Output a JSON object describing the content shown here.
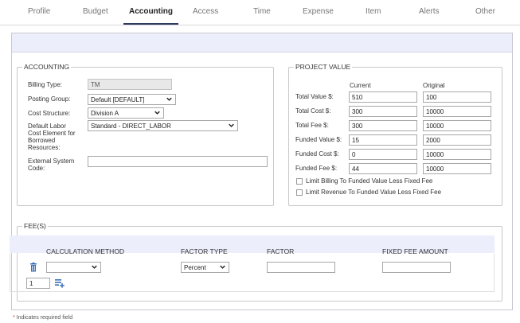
{
  "tabs": [
    {
      "label": "Profile"
    },
    {
      "label": "Budget"
    },
    {
      "label": "Accounting"
    },
    {
      "label": "Access"
    },
    {
      "label": "Time"
    },
    {
      "label": "Expense"
    },
    {
      "label": "Item"
    },
    {
      "label": "Alerts"
    },
    {
      "label": "Other"
    }
  ],
  "accounting": {
    "legend": "ACCOUNTING",
    "billing_type_label": "Billing Type:",
    "billing_type_value": "TM",
    "posting_group_label": "Posting Group:",
    "posting_group_value": "Default [DEFAULT]",
    "cost_structure_label": "Cost Structure:",
    "cost_structure_value": "Division A",
    "labor_cost_label_1": "Default Labor",
    "labor_cost_label_2": "Cost Element for",
    "labor_cost_label_3": "Borrowed",
    "labor_cost_label_4": "Resources:",
    "labor_cost_value": "Standard - DIRECT_LABOR",
    "external_code_label_1": "External System",
    "external_code_label_2": "Code:",
    "external_code_value": ""
  },
  "project_value": {
    "legend": "PROJECT VALUE",
    "col_current": "Current",
    "col_original": "Original",
    "rows": [
      {
        "label": "Total Value $:",
        "current": "510",
        "original": "100"
      },
      {
        "label": "Total Cost $:",
        "current": "300",
        "original": "10000"
      },
      {
        "label": "Total Fee $:",
        "current": "300",
        "original": "10000"
      },
      {
        "label": "Funded Value $:",
        "current": "15",
        "original": "2000"
      },
      {
        "label": "Funded Cost $:",
        "current": "0",
        "original": "10000"
      },
      {
        "label": "Funded Fee $:",
        "current": "44",
        "original": "10000"
      }
    ],
    "limit_billing_label": "Limit Billing To Funded Value Less Fixed Fee",
    "limit_revenue_label": "Limit Revenue To Funded Value Less Fixed Fee"
  },
  "fees": {
    "legend": "FEE(S)",
    "col_calc": "CALCULATION METHOD",
    "col_factor_type": "FACTOR TYPE",
    "col_factor": "FACTOR",
    "col_fixed_fee": "FIXED FEE AMOUNT",
    "row": {
      "calc_method": "",
      "factor_type": "Percent",
      "factor": "",
      "fixed_fee": ""
    },
    "add_count": "1"
  },
  "footnote": {
    "star": "*",
    "text": " Indicates required field"
  },
  "colors": {
    "accent": "#2d3a5c",
    "header_band": "#eceefb",
    "trash_icon": "#3b6fb6",
    "required_star": "#c0392b"
  }
}
